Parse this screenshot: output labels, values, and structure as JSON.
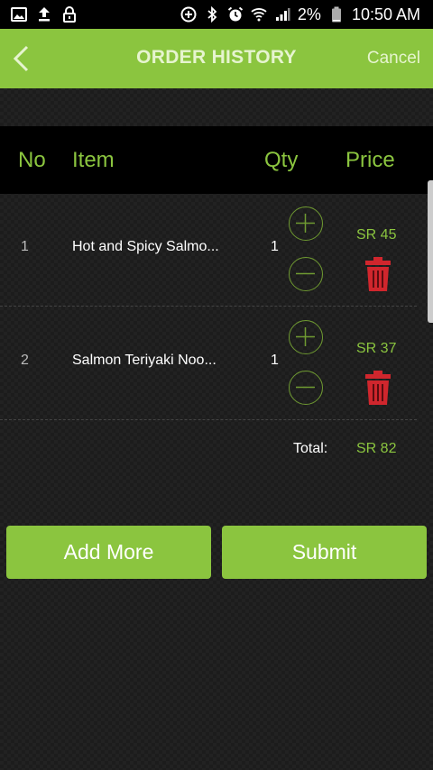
{
  "status_bar": {
    "battery": "2%",
    "time": "10:50 AM"
  },
  "header": {
    "title": "ORDER HISTORY",
    "cancel": "Cancel"
  },
  "table": {
    "columns": [
      "No",
      "Item",
      "Qty",
      "Price"
    ],
    "rows": [
      {
        "no": "1",
        "item": "Hot and Spicy Salmo...",
        "qty": "1",
        "price": "SR 45"
      },
      {
        "no": "2",
        "item": "Salmon Teriyaki Noo...",
        "qty": "1",
        "price": "SR 37"
      }
    ]
  },
  "total": {
    "label": "Total:",
    "value": "SR 82"
  },
  "buttons": {
    "add_more": "Add More",
    "submit": "Submit"
  },
  "colors": {
    "accent": "#8bc53f",
    "delete": "#d0262d"
  }
}
